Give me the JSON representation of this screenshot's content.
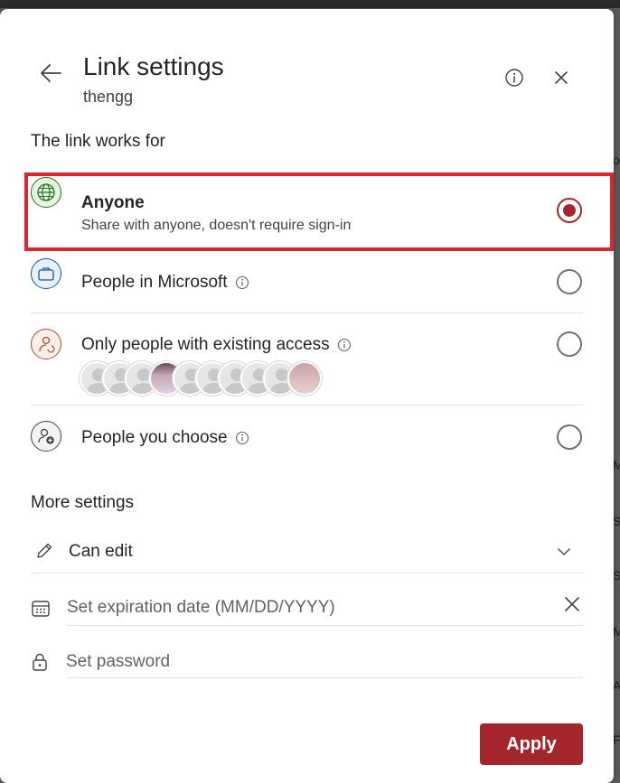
{
  "header": {
    "title": "Link settings",
    "subtitle": "thengg"
  },
  "sections": {
    "link_works_for": "The link works for",
    "more_settings": "More settings"
  },
  "options": [
    {
      "label": "Anyone",
      "description": "Share with anyone, doesn't require sign-in",
      "selected": true,
      "icon": "globe-icon"
    },
    {
      "label": "People in Microsoft",
      "selected": false,
      "icon": "briefcase-icon",
      "has_info": true
    },
    {
      "label": "Only people with existing access",
      "selected": false,
      "icon": "person-refresh-icon",
      "has_info": true
    },
    {
      "label": "People you choose",
      "selected": false,
      "icon": "person-add-icon",
      "has_info": true
    }
  ],
  "more_settings": {
    "permission": {
      "value": "Can edit",
      "icon": "pencil-icon"
    },
    "expiration": {
      "placeholder": "Set expiration date (MM/DD/YYYY)",
      "icon": "calendar-icon"
    },
    "password": {
      "placeholder": "Set password",
      "icon": "lock-icon"
    }
  },
  "apply_label": "Apply",
  "colors": {
    "accent": "#a4262c",
    "highlight": "#e0242e"
  }
}
